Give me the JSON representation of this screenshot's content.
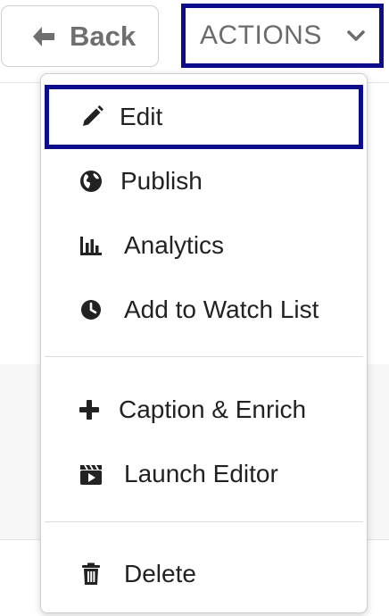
{
  "toolbar": {
    "back_label": "Back",
    "actions_label": "ACTIONS"
  },
  "menu": {
    "items": [
      {
        "label": "Edit",
        "icon": "pencil-icon"
      },
      {
        "label": "Publish",
        "icon": "globe-icon"
      },
      {
        "label": "Analytics",
        "icon": "bar-chart-icon"
      },
      {
        "label": "Add to Watch List",
        "icon": "clock-icon"
      },
      {
        "label": "Caption & Enrich",
        "icon": "plus-icon"
      },
      {
        "label": "Launch Editor",
        "icon": "clapperboard-icon"
      },
      {
        "label": "Delete",
        "icon": "trash-icon"
      }
    ]
  },
  "colors": {
    "focus_border": "#0d0d8c",
    "text": "#222222",
    "muted_text": "#6b6b6b"
  }
}
